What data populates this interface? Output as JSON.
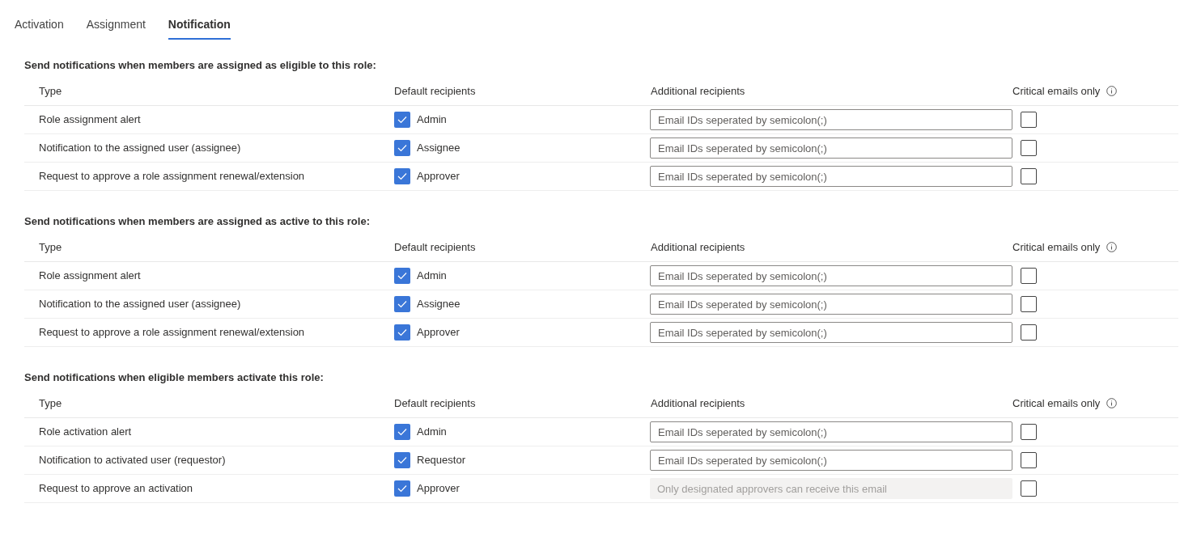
{
  "tabs": [
    {
      "label": "Activation",
      "selected": false
    },
    {
      "label": "Assignment",
      "selected": false
    },
    {
      "label": "Notification",
      "selected": true
    }
  ],
  "sections": [
    {
      "heading": "Send notifications when members are assigned as eligible to this role:",
      "columns": [
        "Type",
        "Default recipients",
        "Additional recipients",
        "Critical emails only"
      ],
      "rows": [
        {
          "type": "Role assignment alert",
          "recipient": "Admin",
          "default_checked": true,
          "placeholder": "Email IDs seperated by semicolon(;)",
          "disabled": false,
          "critical": false
        },
        {
          "type": "Notification to the assigned user (assignee)",
          "recipient": "Assignee",
          "default_checked": true,
          "placeholder": "Email IDs seperated by semicolon(;)",
          "disabled": false,
          "critical": false
        },
        {
          "type": "Request to approve a role assignment renewal/extension",
          "recipient": "Approver",
          "default_checked": true,
          "placeholder": "Email IDs seperated by semicolon(;)",
          "disabled": false,
          "critical": false
        }
      ]
    },
    {
      "heading": "Send notifications when members are assigned as active to this role:",
      "columns": [
        "Type",
        "Default recipients",
        "Additional recipients",
        "Critical emails only"
      ],
      "rows": [
        {
          "type": "Role assignment alert",
          "recipient": "Admin",
          "default_checked": true,
          "placeholder": "Email IDs seperated by semicolon(;)",
          "disabled": false,
          "critical": false
        },
        {
          "type": "Notification to the assigned user (assignee)",
          "recipient": "Assignee",
          "default_checked": true,
          "placeholder": "Email IDs seperated by semicolon(;)",
          "disabled": false,
          "critical": false
        },
        {
          "type": "Request to approve a role assignment renewal/extension",
          "recipient": "Approver",
          "default_checked": true,
          "placeholder": "Email IDs seperated by semicolon(;)",
          "disabled": false,
          "critical": false
        }
      ]
    },
    {
      "heading": "Send notifications when eligible members activate this role:",
      "columns": [
        "Type",
        "Default recipients",
        "Additional recipients",
        "Critical emails only"
      ],
      "rows": [
        {
          "type": "Role activation alert",
          "recipient": "Admin",
          "default_checked": true,
          "placeholder": "Email IDs seperated by semicolon(;)",
          "disabled": false,
          "critical": false
        },
        {
          "type": "Notification to activated user (requestor)",
          "recipient": "Requestor",
          "default_checked": true,
          "placeholder": "Email IDs seperated by semicolon(;)",
          "disabled": false,
          "critical": false
        },
        {
          "type": "Request to approve an activation",
          "recipient": "Approver",
          "default_checked": true,
          "placeholder": "Only designated approvers can receive this email",
          "disabled": true,
          "critical": false
        }
      ]
    }
  ]
}
